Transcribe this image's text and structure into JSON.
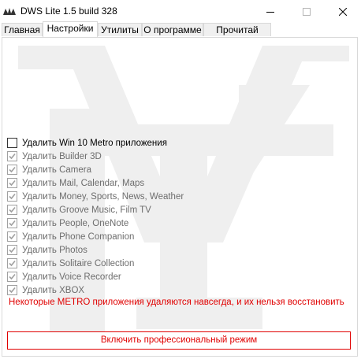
{
  "window": {
    "title": "DWS Lite 1.5 build 328"
  },
  "tabs": [
    {
      "label": "Главная",
      "active": false
    },
    {
      "label": "Настройки",
      "active": true
    },
    {
      "label": "Утилиты",
      "active": false
    },
    {
      "label": "О программе",
      "active": false
    },
    {
      "label": "Прочитай меня",
      "active": false
    }
  ],
  "settings": {
    "master_checkbox": {
      "label": "Удалить Win 10 Metro приложения",
      "checked": false,
      "enabled": true
    },
    "items": [
      {
        "label": "Удалить Builder 3D",
        "checked": true,
        "enabled": false
      },
      {
        "label": "Удалить Camera",
        "checked": true,
        "enabled": false
      },
      {
        "label": "Удалить Mail, Calendar, Maps",
        "checked": true,
        "enabled": false
      },
      {
        "label": "Удалить Money, Sports, News, Weather",
        "checked": true,
        "enabled": false
      },
      {
        "label": "Удалить Groove Music, Film TV",
        "checked": true,
        "enabled": false
      },
      {
        "label": "Удалить People, OneNote",
        "checked": true,
        "enabled": false
      },
      {
        "label": "Удалить Phone Companion",
        "checked": true,
        "enabled": false
      },
      {
        "label": "Удалить Photos",
        "checked": true,
        "enabled": false
      },
      {
        "label": "Удалить Solitaire Collection",
        "checked": true,
        "enabled": false
      },
      {
        "label": "Удалить Voice Recorder",
        "checked": true,
        "enabled": false
      },
      {
        "label": "Удалить XBOX",
        "checked": true,
        "enabled": false
      }
    ],
    "warning": "Некоторые METRO приложения удаляются навсегда, и их нельзя восстановить",
    "pro_mode_button": "Включить профессиональный режим"
  },
  "colors": {
    "warning": "#e00000",
    "disabled_text": "#6d6d6d",
    "border": "#d9d9d9",
    "watermark": "#efefef"
  }
}
